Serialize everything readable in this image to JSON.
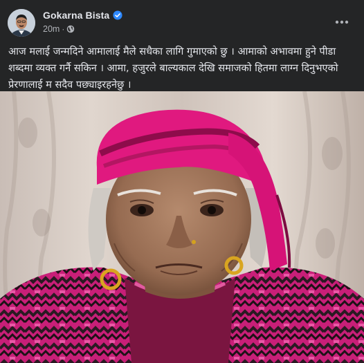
{
  "post": {
    "author": "Gokarna Bista",
    "time": "20m",
    "separator": "·",
    "text": "आज मलाई जन्मदिने आमालाई मैले सधैका लागि गुमाएको छु । आमाको अभावमा हुने पीडा शब्दमा व्यक्त गर्नै सकिन । आमा, हजुरले बाल्यकाल देखि समाजको हितमा लाग्न दिनुभएको प्रेरणालाई म सदैव पछ्याइरहनेछु ।",
    "more_label": "•••",
    "photo_alt": "Portrait of an elderly woman wearing a pink headscarf and a pink patterned sweater"
  },
  "colors": {
    "background": "#242526",
    "text_primary": "#e4e6eb",
    "text_secondary": "#b0b3b8",
    "verified": "#2d88ff",
    "scarf": "#e0197f",
    "sweater_pink": "#d01f7c",
    "sweater_dark": "#2a1a22"
  },
  "icons": {
    "verified": "verified-badge-icon",
    "privacy": "globe-icon",
    "more": "more-options-icon"
  }
}
